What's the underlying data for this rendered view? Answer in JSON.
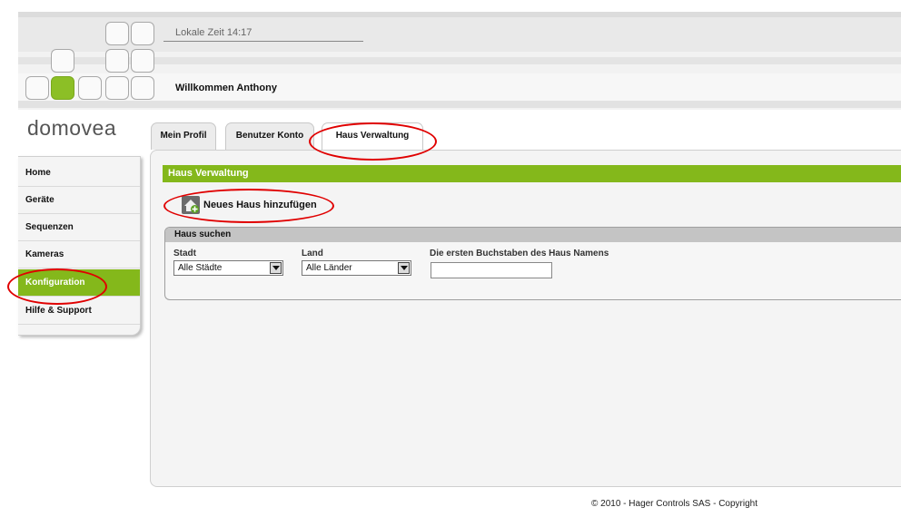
{
  "header": {
    "local_time": "Lokale Zeit 14:17",
    "welcome": "Willkommen Anthony"
  },
  "brand": {
    "logo": "domovea"
  },
  "tabs": [
    {
      "label": "Mein Profil",
      "active": false
    },
    {
      "label": "Benutzer Konto",
      "active": false
    },
    {
      "label": "Haus Verwaltung",
      "active": true
    }
  ],
  "sidebar": {
    "items": [
      {
        "label": "Home",
        "active": false
      },
      {
        "label": "Geräte",
        "active": false
      },
      {
        "label": "Sequenzen",
        "active": false
      },
      {
        "label": "Kameras",
        "active": false
      },
      {
        "label": "Konfiguration",
        "active": true
      },
      {
        "label": "Hilfe & Support",
        "active": false
      }
    ]
  },
  "main": {
    "section_title": "Haus Verwaltung",
    "add_house": {
      "label": "Neues Haus hinzufügen",
      "icon": "house-add-icon"
    },
    "search": {
      "title": "Haus suchen",
      "city_label": "Stadt",
      "city_value": "Alle Städte",
      "country_label": "Land",
      "country_value": "Alle Länder",
      "name_label": "Die ersten Buchstaben des Haus Namens",
      "name_value": ""
    }
  },
  "footer": {
    "text": "© 2010 - Hager Controls SAS - Copyright"
  },
  "colors": {
    "accent": "#84b81b",
    "annotation": "#e00000"
  }
}
